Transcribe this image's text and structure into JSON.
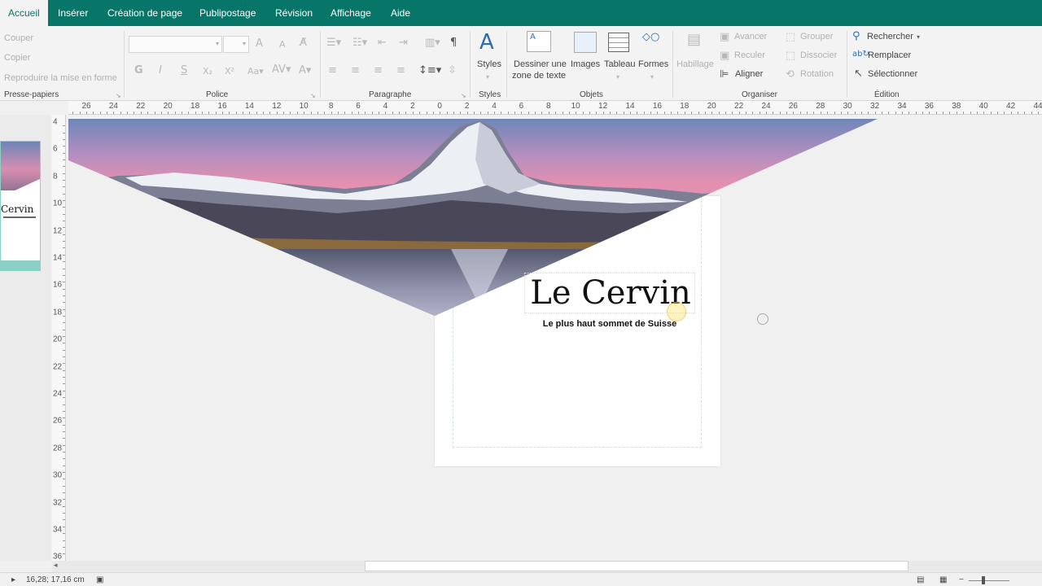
{
  "tabs": [
    {
      "label": "Accueil",
      "active": true
    },
    {
      "label": "Insérer"
    },
    {
      "label": "Création de page"
    },
    {
      "label": "Publipostage"
    },
    {
      "label": "Révision"
    },
    {
      "label": "Affichage"
    },
    {
      "label": "Aide"
    }
  ],
  "ribbon": {
    "clipboard": {
      "cut": "Couper",
      "copy": "Copier",
      "format_painter": "Reproduire la mise en forme",
      "group": "Presse-papiers"
    },
    "font": {
      "group": "Police"
    },
    "paragraph": {
      "group": "Paragraphe"
    },
    "styles": {
      "button": "Styles",
      "group": "Styles"
    },
    "objects": {
      "draw_textbox_line1": "Dessiner une",
      "draw_textbox_line2": "zone de texte",
      "images": "Images",
      "table": "Tableau",
      "shapes": "Formes",
      "group": "Objets"
    },
    "arrange": {
      "wrap": "Habillage",
      "forward": "Avancer",
      "backward": "Reculer",
      "align": "Aligner",
      "group_btn": "Grouper",
      "ungroup": "Dissocier",
      "rotate": "Rotation",
      "group": "Organiser"
    },
    "editing": {
      "find": "Rechercher",
      "replace": "Remplacer",
      "select": "Sélectionner",
      "group": "Édition"
    }
  },
  "rulers": {
    "horizontal": [
      "26",
      "24",
      "22",
      "20",
      "18",
      "16",
      "14",
      "12",
      "10",
      "8",
      "6",
      "4",
      "2",
      "0",
      "2",
      "4",
      "6",
      "8",
      "10",
      "12",
      "14",
      "16",
      "18",
      "20",
      "22",
      "24",
      "26",
      "28",
      "30",
      "32",
      "34",
      "36",
      "38",
      "40",
      "42",
      "44"
    ],
    "vertical": [
      "4",
      "6",
      "8",
      "10",
      "12",
      "14",
      "16",
      "18",
      "20",
      "22",
      "24",
      "26",
      "28",
      "30",
      "32",
      "34",
      "36"
    ]
  },
  "document": {
    "title": "Le Cervin",
    "subtitle": "Le plus haut sommet de Suisse"
  },
  "thumbnail": {
    "title": "Cervin"
  },
  "status": {
    "position": "16,28; 17,16 cm"
  },
  "colors": {
    "accent": "#077568"
  }
}
